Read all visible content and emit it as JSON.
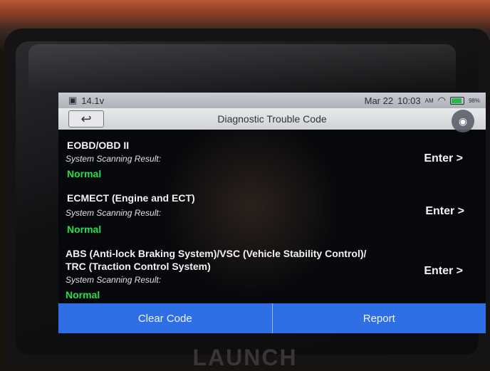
{
  "status_bar": {
    "voltage": "14.1v",
    "date": "Mar 22",
    "time": "10:03",
    "ampm": "AM",
    "battery": "98%"
  },
  "title_bar": {
    "back_icon": "back-arrow-icon",
    "title": "Diagnostic Trouble Code",
    "camera_icon": "camera-icon"
  },
  "systems": [
    {
      "name": "EOBD/OBD II",
      "sub": "System Scanning Result:",
      "status": "Normal",
      "enter": "Enter >"
    },
    {
      "name": "ECMECT (Engine and ECT)",
      "sub": "System Scanning Result:",
      "status": "Normal",
      "enter": "Enter >"
    },
    {
      "name_line1": "ABS (Anti-lock Braking System)/VSC (Vehicle Stability Control)/",
      "name_line2": "TRC (Traction Control System)",
      "sub": "System Scanning Result:",
      "status": "Normal",
      "enter": "Enter >"
    }
  ],
  "footer": {
    "clear": "Clear Code",
    "report": "Report"
  },
  "brand": "LAUNCH",
  "colors": {
    "accent_blue": "#2e6fe6",
    "status_green": "#22e04a"
  }
}
